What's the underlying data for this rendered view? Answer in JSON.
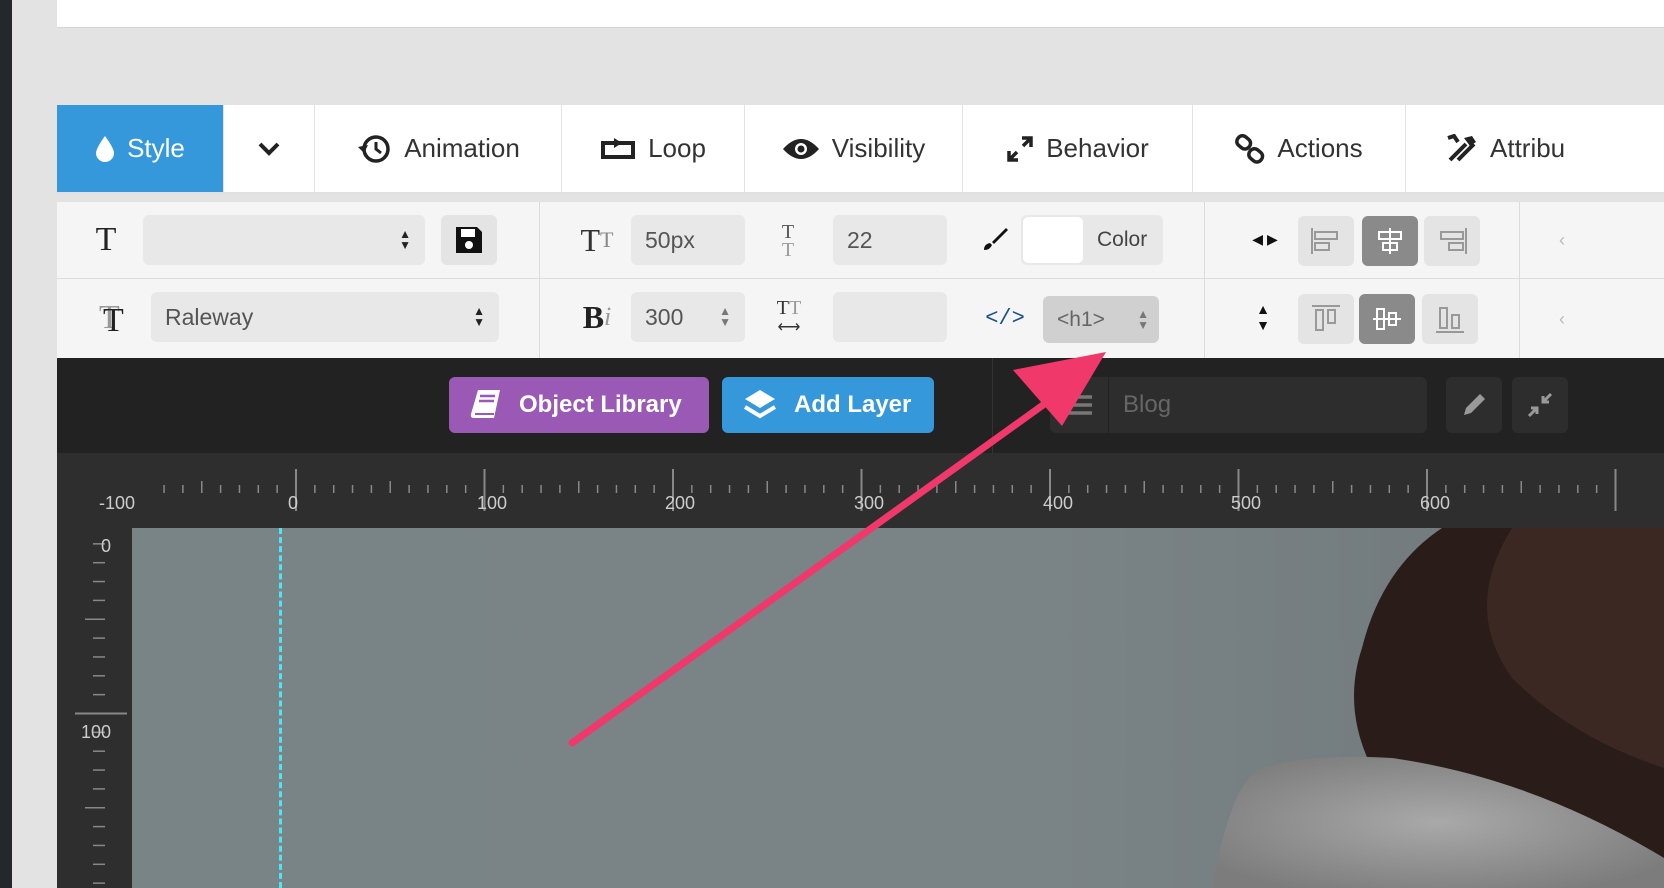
{
  "tabs": [
    {
      "label": "Style",
      "icon": "droplet-icon"
    },
    {
      "label": "",
      "icon": "chevron-down-icon"
    },
    {
      "label": "Animation",
      "icon": "history-icon"
    },
    {
      "label": "Loop",
      "icon": "loop-icon"
    },
    {
      "label": "Visibility",
      "icon": "eye-icon"
    },
    {
      "label": "Behavior",
      "icon": "expand-icon"
    },
    {
      "label": "Actions",
      "icon": "link-icon"
    },
    {
      "label": "Attribu",
      "icon": "tools-icon"
    }
  ],
  "toolbar": {
    "font_size": "50px",
    "line_height": "22",
    "color_label": "Color",
    "font_family": "Raleway",
    "font_weight": "300",
    "letter_spacing": "",
    "tag": "<h1>",
    "preset": ""
  },
  "darkbar": {
    "object_library": "Object Library",
    "add_layer": "Add Layer",
    "slide_name": "Blog"
  },
  "ruler": {
    "h_labels": [
      "-100",
      "0",
      "100",
      "200",
      "300",
      "400",
      "500",
      "600"
    ],
    "v_labels": [
      "0",
      "100"
    ]
  },
  "colors": {
    "accent_blue": "#3498db",
    "purple": "#9b59b6",
    "arrow_pink": "#f0386b",
    "guide_cyan": "#4ee3f5"
  }
}
